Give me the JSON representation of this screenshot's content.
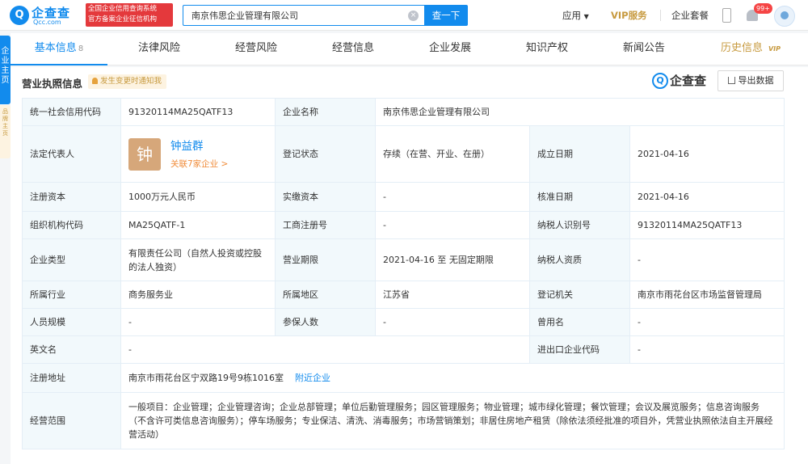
{
  "header": {
    "logo_name": "企查查",
    "logo_mark": "Q",
    "logo_domain": "Qcc.com",
    "badge_line1": "全国企业信用查询系统",
    "badge_line2": "官方备案企业征信机构",
    "search_value": "南京伟思企业管理有限公司",
    "search_button": "查一下",
    "apps": "应用",
    "vip": "VIP服务",
    "plan": "企业套餐",
    "notif_count": "99+"
  },
  "sidebar": {
    "blue_tab": "企业主页",
    "yellow_tab": "品牌主页"
  },
  "tabs": [
    {
      "label": "基本信息",
      "count": "8"
    },
    {
      "label": "法律风险"
    },
    {
      "label": "经营风险"
    },
    {
      "label": "经营信息"
    },
    {
      "label": "企业发展"
    },
    {
      "label": "知识产权"
    },
    {
      "label": "新闻公告"
    },
    {
      "label": "历史信息",
      "tag": "VIP"
    }
  ],
  "section": {
    "title": "营业执照信息",
    "notify": "发生变更时通知我",
    "brand": "企查查",
    "brand_mark": "Q",
    "export": "导出数据"
  },
  "info": {
    "credit_code_label": "统一社会信用代码",
    "credit_code": "91320114MA25QATF13",
    "company_name_label": "企业名称",
    "company_name": "南京伟思企业管理有限公司",
    "legal_rep_label": "法定代表人",
    "legal_rep_avatar": "钟",
    "legal_rep_name": "钟益群",
    "legal_rep_link": "关联7家企业 >",
    "reg_status_label": "登记状态",
    "reg_status": "存续（在营、开业、在册）",
    "est_date_label": "成立日期",
    "est_date": "2021-04-16",
    "reg_capital_label": "注册资本",
    "reg_capital": "1000万元人民币",
    "paid_capital_label": "实缴资本",
    "paid_capital": "-",
    "approve_date_label": "核准日期",
    "approve_date": "2021-04-16",
    "org_code_label": "组织机构代码",
    "org_code": "MA25QATF-1",
    "biz_reg_no_label": "工商注册号",
    "biz_reg_no": "-",
    "taxpayer_id_label": "纳税人识别号",
    "taxpayer_id": "91320114MA25QATF13",
    "company_type_label": "企业类型",
    "company_type": "有限责任公司（自然人投资或控股的法人独资）",
    "biz_term_label": "营业期限",
    "biz_term": "2021-04-16 至 无固定期限",
    "taxpayer_qual_label": "纳税人资质",
    "taxpayer_qual": "-",
    "industry_label": "所属行业",
    "industry": "商务服务业",
    "region_label": "所属地区",
    "region": "江苏省",
    "reg_authority_label": "登记机关",
    "reg_authority": "南京市雨花台区市场监督管理局",
    "staff_size_label": "人员规模",
    "staff_size": "-",
    "insured_label": "参保人数",
    "insured": "-",
    "former_name_label": "曾用名",
    "former_name": "-",
    "english_name_label": "英文名",
    "english_name": "-",
    "import_export_label": "进出口企业代码",
    "import_export": "-",
    "reg_address_label": "注册地址",
    "reg_address": "南京市雨花台区宁双路19号9栋1016室",
    "nearby_link": "附近企业",
    "biz_scope_label": "经营范围",
    "biz_scope": "一般项目：企业管理；企业管理咨询；企业总部管理；单位后勤管理服务；园区管理服务；物业管理；城市绿化管理；餐饮管理；会议及展览服务；信息咨询服务（不含许可类信息咨询服务）；停车场服务；专业保洁、清洗、消毒服务；市场营销策划；非居住房地产租赁（除依法须经批准的项目外，凭营业执照依法自主开展经营活动）"
  }
}
